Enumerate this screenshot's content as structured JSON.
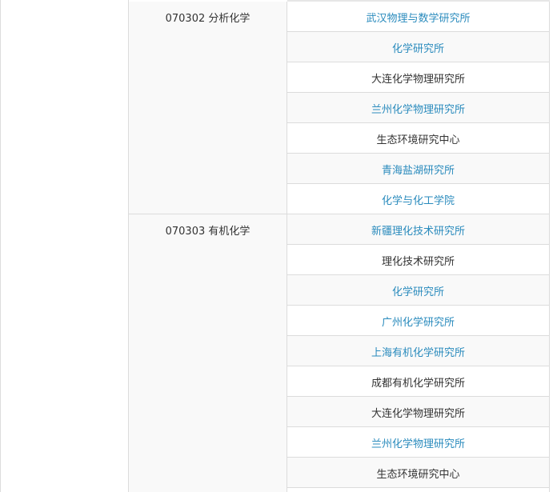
{
  "groups": [
    {
      "major": "070302 分析化学",
      "units": [
        {
          "name": "武汉物理与数学研究所",
          "link": true
        },
        {
          "name": "化学研究所",
          "link": true
        },
        {
          "name": "大连化学物理研究所",
          "link": false
        },
        {
          "name": "兰州化学物理研究所",
          "link": true
        },
        {
          "name": "生态环境研究中心",
          "link": false
        },
        {
          "name": "青海盐湖研究所",
          "link": true
        },
        {
          "name": "化学与化工学院",
          "link": true
        }
      ]
    },
    {
      "major": "070303 有机化学",
      "units": [
        {
          "name": "新疆理化技术研究所",
          "link": true
        },
        {
          "name": "理化技术研究所",
          "link": false
        },
        {
          "name": "化学研究所",
          "link": true
        },
        {
          "name": "广州化学研究所",
          "link": true
        },
        {
          "name": "上海有机化学研究所",
          "link": true
        },
        {
          "name": "成都有机化学研究所",
          "link": false
        },
        {
          "name": "大连化学物理研究所",
          "link": false
        },
        {
          "name": "兰州化学物理研究所",
          "link": true
        },
        {
          "name": "生态环境研究中心",
          "link": false
        }
      ]
    }
  ],
  "colors": {
    "link": "#2a8bbd",
    "text": "#333333",
    "border": "#dcdcdc",
    "alt_row": "#f9f9f9"
  }
}
